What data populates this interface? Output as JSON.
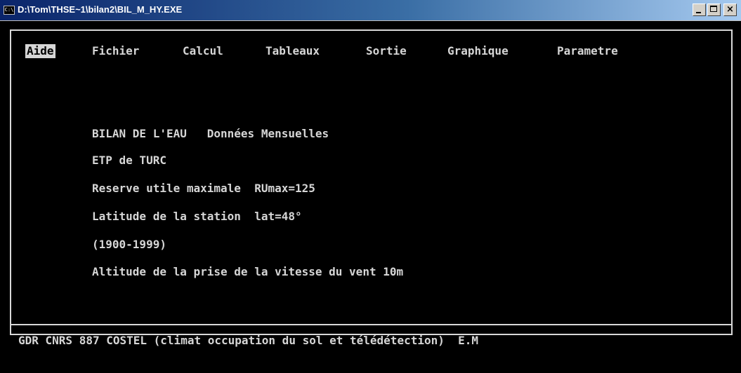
{
  "window": {
    "title": "D:\\Tom\\THSE~1\\bilan2\\BIL_M_HY.EXE",
    "icon": "console-icon"
  },
  "menu": {
    "items": [
      {
        "label": "Aide"
      },
      {
        "label": "Fichier"
      },
      {
        "label": "Calcul"
      },
      {
        "label": "Tableaux"
      },
      {
        "label": "Sortie"
      },
      {
        "label": "Graphique"
      },
      {
        "label": "Parametre"
      }
    ]
  },
  "content": {
    "heading": "BILAN DE L'EAU   Données Mensuelles",
    "lines": [
      "ETP de TURC",
      "Reserve utile maximale  RUmax=125",
      "Latitude de la station  lat=48°",
      "(1900-1999)",
      "Altitude de la prise de la vitesse du vent 10m"
    ]
  },
  "status": {
    "text": "GDR CNRS 887 COSTEL (climat occupation du sol et télédétection)  E.M"
  },
  "colors": {
    "background": "#000000",
    "text": "#d6d6d6",
    "title_bar": "#0a246a"
  }
}
